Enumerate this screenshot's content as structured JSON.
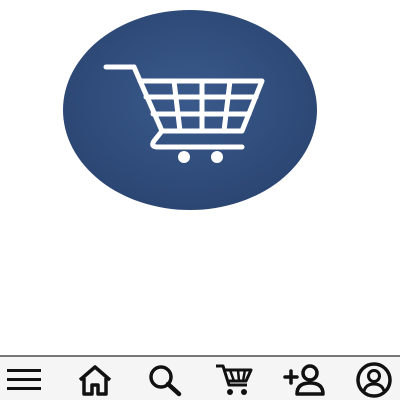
{
  "app": {
    "logo_icon": "shopping-cart-icon",
    "logo_colors": {
      "circle": "#2f4a78",
      "cart": "#ffffff"
    }
  },
  "bottom_nav": {
    "background": "#f5f5f5",
    "icon_color": "#111111",
    "items": [
      {
        "icon": "hamburger-menu-icon"
      },
      {
        "icon": "home-icon"
      },
      {
        "icon": "search-icon"
      },
      {
        "icon": "shopping-cart-icon"
      },
      {
        "icon": "add-person-icon"
      },
      {
        "icon": "account-circle-icon"
      }
    ]
  }
}
